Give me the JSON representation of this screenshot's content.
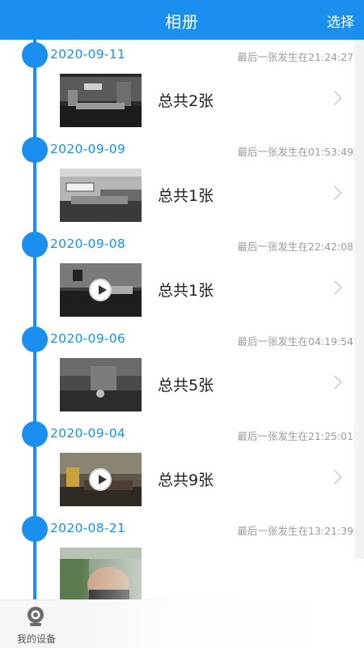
{
  "header": {
    "title": "相册",
    "select_label": "选择"
  },
  "groups": [
    {
      "date": "2020-09-11",
      "last": "最后一张发生在21:24:27",
      "count": "总共2张",
      "video": false
    },
    {
      "date": "2020-09-09",
      "last": "最后一张发生在01:53:49",
      "count": "总共1张",
      "video": false
    },
    {
      "date": "2020-09-08",
      "last": "最后一张发生在22:42:08",
      "count": "总共1张",
      "video": true
    },
    {
      "date": "2020-09-06",
      "last": "最后一张发生在04:19:54",
      "count": "总共5张",
      "video": false
    },
    {
      "date": "2020-09-04",
      "last": "最后一张发生在21:25:01",
      "count": "总共9张",
      "video": true
    },
    {
      "date": "2020-08-21",
      "last": "最后一张发生在13:21:39",
      "count": "",
      "video": false
    }
  ],
  "bottom_nav": {
    "tab_label": "我的设备",
    "tab_icon": "camera-device-icon"
  },
  "colors": {
    "accent": "#1a8ff0",
    "muted_text": "#9a9a9a"
  }
}
